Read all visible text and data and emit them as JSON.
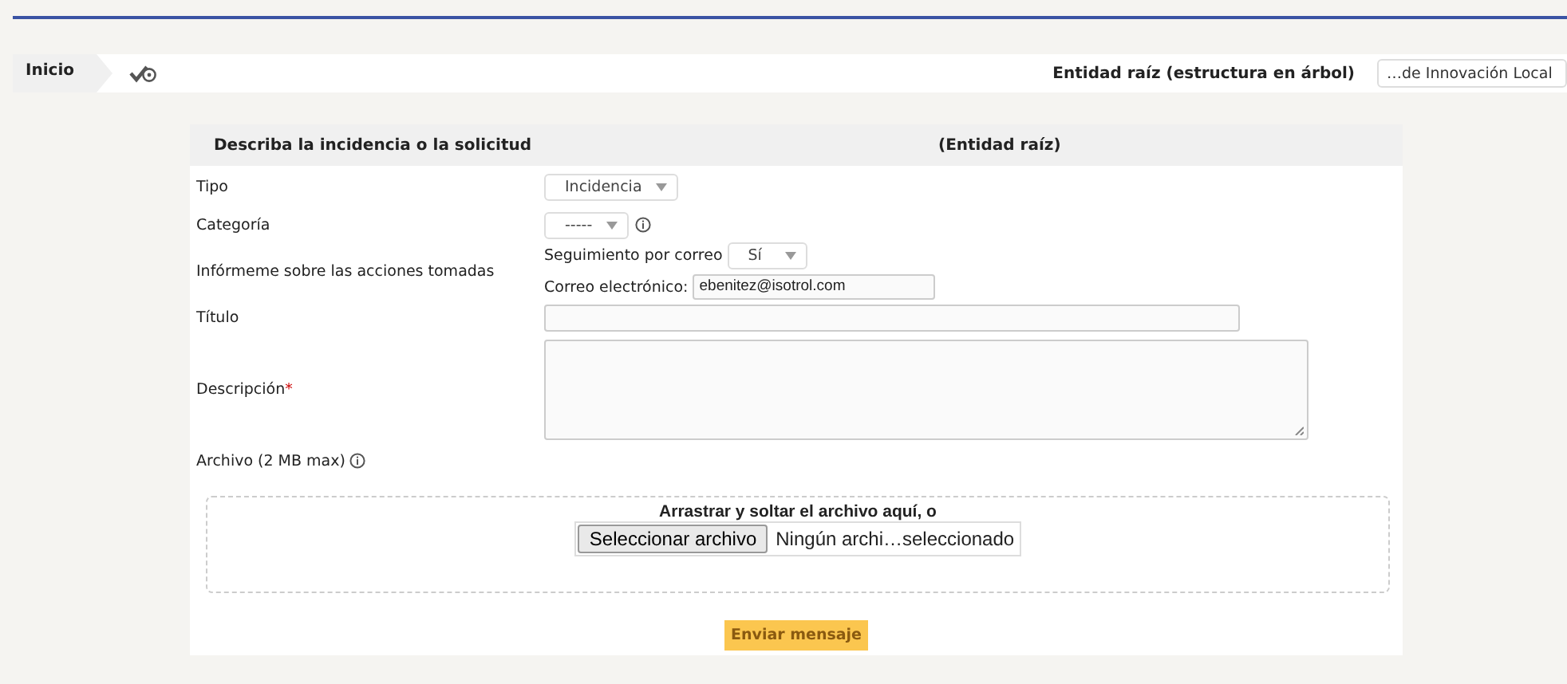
{
  "breadcrumb": {
    "items": [
      {
        "label": "Inicio"
      }
    ]
  },
  "entity_selector": {
    "label": "Entidad raíz (estructura en árbol)",
    "value": "…de Innovación Local"
  },
  "form": {
    "title": "Describa la incidencia o la solicitud",
    "entity": "(Entidad raíz)",
    "fields": [
      {
        "kind": "select",
        "label": "Tipo",
        "value": "Incidencia",
        "info": false
      },
      {
        "kind": "select",
        "label": "Categoría",
        "value": "-----",
        "info": true
      },
      {
        "kind": "followup",
        "label": "Infórmeme sobre las acciones tomadas",
        "follow_label": "Seguimiento por correo",
        "follow_value": "Sí",
        "email_label": "Correo electrónico:",
        "email_value": "ebenitez@isotrol.com"
      },
      {
        "kind": "text",
        "label": "Título"
      },
      {
        "kind": "textarea",
        "label": "Descripción",
        "required_mark": "*"
      },
      {
        "kind": "file",
        "label": "Archivo (2 MB max)",
        "info": true
      }
    ],
    "dropzone": {
      "text": "Arrastrar y soltar el archivo aquí, o",
      "button": "Seleccionar archivo",
      "status": "Ningún archi…seleccionado"
    },
    "submit": "Enviar mensaje"
  }
}
